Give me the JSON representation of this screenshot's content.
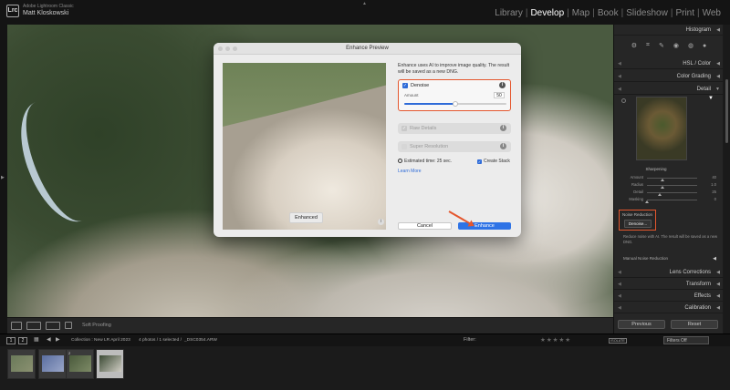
{
  "app": {
    "brand": "Adobe Lightroom Classic",
    "user": "Matt Kloskowski",
    "logo_text": "Lrc"
  },
  "modules": [
    {
      "label": "Library",
      "active": false
    },
    {
      "label": "Develop",
      "active": true
    },
    {
      "label": "Map",
      "active": false
    },
    {
      "label": "Book",
      "active": false
    },
    {
      "label": "Slideshow",
      "active": false
    },
    {
      "label": "Print",
      "active": false
    },
    {
      "label": "Web",
      "active": false
    }
  ],
  "dialog": {
    "title": "Enhance Preview",
    "preview_badge": "Enhanced",
    "description": "Enhance uses AI to improve image quality. The result will be saved as a new DNG.",
    "denoise": {
      "label": "Denoise",
      "checked": true,
      "amount_label": "Amount",
      "amount": "50",
      "amount_value": 50,
      "amount_max": 100
    },
    "raw_details": {
      "label": "Raw Details",
      "checked": true,
      "enabled": false
    },
    "super_resolution": {
      "label": "Super Resolution",
      "checked": false,
      "enabled": false
    },
    "estimated_time": "Estimated time: 25 sec.",
    "create_stack": {
      "label": "Create Stack",
      "checked": true
    },
    "learn_more": "Learn More",
    "cancel_label": "Cancel",
    "enhance_label": "Enhance"
  },
  "right_panel": {
    "histogram": "Histogram",
    "hsl": "HSL / Color",
    "color_grading": "Color Grading",
    "detail": "Detail",
    "sharpening": {
      "title": "Sharpening",
      "rows": [
        {
          "label": "Amount",
          "value": "40",
          "pos": 0.3
        },
        {
          "label": "Radius",
          "value": "1.0",
          "pos": 0.3
        },
        {
          "label": "Detail",
          "value": "25",
          "pos": 0.25
        },
        {
          "label": "Masking",
          "value": "0",
          "pos": 0.0
        }
      ]
    },
    "noise_reduction": {
      "title": "Noise Reduction",
      "button": "Denoise...",
      "description": "Reduce noise with AI. The result will be saved as a new DNG.",
      "manual": "Manual Noise Reduction"
    },
    "lens_corrections": "Lens Corrections",
    "transform": "Transform",
    "effects": "Effects",
    "calibration": "Calibration",
    "previous_label": "Previous",
    "reset_label": "Reset"
  },
  "toolbar": {
    "soft_proofing": "Soft Proofing"
  },
  "filmstrip_bar": {
    "page1": "1",
    "page2": "2",
    "source": "Collection : New LR April 2023",
    "count": "4 photos / 1 selected /",
    "filename": "_DSC0354.ARW",
    "filter_label": "Filter:",
    "stars": "★★★★★",
    "color_label": "ISOLATE",
    "filters_off": "Filters Off"
  },
  "filmstrip": {
    "thumbs": [
      {
        "selected": false,
        "stack_badge": "",
        "colors": [
          "#6a7a5a",
          "#8a9070"
        ]
      },
      {
        "selected": false,
        "stack_badge": "2",
        "colors": [
          "#5a6ea0",
          "#9aa6c8"
        ]
      },
      {
        "selected": false,
        "stack_badge": "",
        "colors": [
          "#4a5a3c",
          "#7d8a66"
        ]
      },
      {
        "selected": true,
        "stack_badge": "",
        "colors": [
          "#3b4a34",
          "#d0cdc4"
        ]
      }
    ]
  },
  "colors": {
    "accent_blue": "#2e73e6",
    "annotation_red": "#e4572e"
  }
}
